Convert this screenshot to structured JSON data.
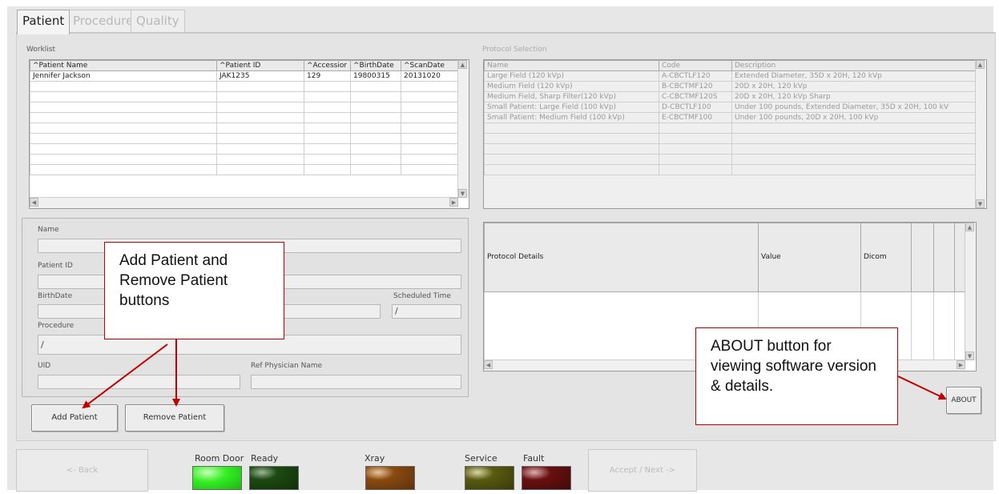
{
  "tabs": [
    {
      "label": "Patient",
      "active": true
    },
    {
      "label": "Procedure",
      "active": false
    },
    {
      "label": "Quality",
      "active": false
    }
  ],
  "worklist": {
    "label": "Worklist",
    "columns": [
      "^Patient Name",
      "^Patient ID",
      "^Accessior",
      "^BirthDate",
      "^ScanDate"
    ],
    "rows": [
      [
        "Jennifer Jackson",
        "JAK1235",
        "129",
        "19800315",
        "20131020"
      ]
    ]
  },
  "protocol_selection": {
    "label": "Protocol Selection",
    "columns": [
      "Name",
      "Code",
      "Description"
    ],
    "rows": [
      [
        "Large Field (120 kVp)",
        "A-CBCTLF120",
        "Extended Diameter, 35D x 20H, 120 kVp"
      ],
      [
        "Medium Field (120 kVp)",
        "B-CBCTMF120",
        "20D x 20H, 120 kVp"
      ],
      [
        "Medium Field, Sharp Filter(120 kVp)",
        "C-CBCTMF120S",
        "20D x 20H, 120 kVp Sharp"
      ],
      [
        "Small Patient: Large Field (100 kVp)",
        "D-CBCTLF100",
        "Under 100 pounds, Extended Diameter, 35D x 20H, 100 kV"
      ],
      [
        "Small Patient: Medium Field (100 kVp)",
        "E-CBCTMF100",
        "Under 100 pounds, 20D x 20H, 100 kVp"
      ]
    ]
  },
  "protocol_details": {
    "columns": [
      "Protocol Details",
      "Value",
      "Dicom"
    ]
  },
  "form": {
    "name_label": "Name",
    "name_value": "",
    "patient_id_label": "Patient ID",
    "patient_id_value": "",
    "birthdate_label": "BirthDate",
    "scheduled_time_label": "Scheduled Time",
    "scheduled_time_value": "/",
    "procedure_label": "Procedure",
    "procedure_value": "/",
    "uid_label": "UID",
    "ref_physician_label": "Ref Physician Name"
  },
  "buttons": {
    "add_patient": "Add Patient",
    "remove_patient": "Remove Patient",
    "about": "ABOUT",
    "back": "<- Back",
    "accept_next": "Accept / Next ->"
  },
  "indicators": [
    {
      "label": "Room Door",
      "color": "#33ee22"
    },
    {
      "label": "Ready",
      "color": "#1d4a12"
    },
    {
      "label": "Xray",
      "color": "#8a4a10"
    },
    {
      "label": "Service",
      "color": "#5a5a10"
    },
    {
      "label": "Fault",
      "color": "#6a1010"
    }
  ],
  "callouts": {
    "add_remove": "Add Patient and Remove Patient buttons",
    "about": "ABOUT button for viewing software version & details."
  }
}
